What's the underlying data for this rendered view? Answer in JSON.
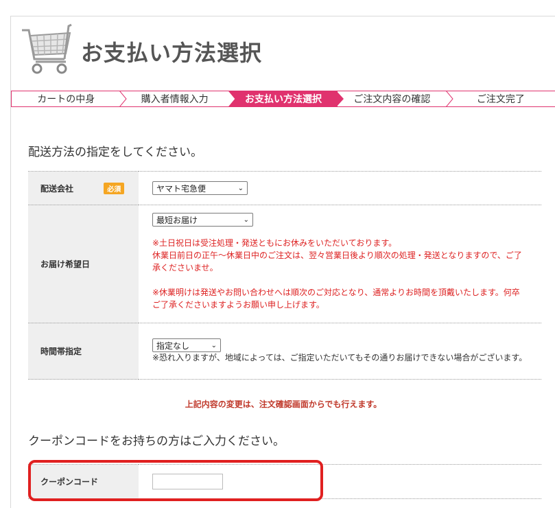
{
  "header": {
    "title": "お支払い方法選択"
  },
  "steps": [
    {
      "label": "カートの中身"
    },
    {
      "label": "購入者情報入力"
    },
    {
      "label": "お支払い方法選択"
    },
    {
      "label": "ご注文内容の確認"
    },
    {
      "label": "ご注文完了"
    }
  ],
  "delivery": {
    "section_title": "配送方法の指定をしてください。",
    "carrier": {
      "label": "配送会社",
      "required_badge": "必須",
      "selected": "ヤマト宅急便"
    },
    "date": {
      "label": "お届け希望日",
      "selected": "最短お届け",
      "note_line1": "※土日祝日は受注処理・発送ともにお休みをいただいております。",
      "note_line2": "休業日前日の正午～休業日中のご注文は、翌々営業日後より順次の処理・発送となりますので、ご了承くださいませ。",
      "note_line3": "※休業明けは発送やお問い合わせへは順次のご対応となり、通常よりお時間を頂戴いたします。何卒ご了承くださいますようお願い申し上げます。"
    },
    "time": {
      "label": "時間帯指定",
      "selected": "指定なし",
      "note": "※恐れ入りますが、地域によっては、ご指定いただいてもその通りお届けできない場合がございます。"
    },
    "change_note": "上記内容の変更は、注文確認画面からでも行えます。"
  },
  "coupon": {
    "section_title": "クーポンコードをお持ちの方はご入力ください。",
    "label": "クーポンコード",
    "value": ""
  },
  "colors": {
    "accent": "#e0326e",
    "required": "#f5a623",
    "note_red": "#dd2222",
    "highlight": "#e02020"
  }
}
